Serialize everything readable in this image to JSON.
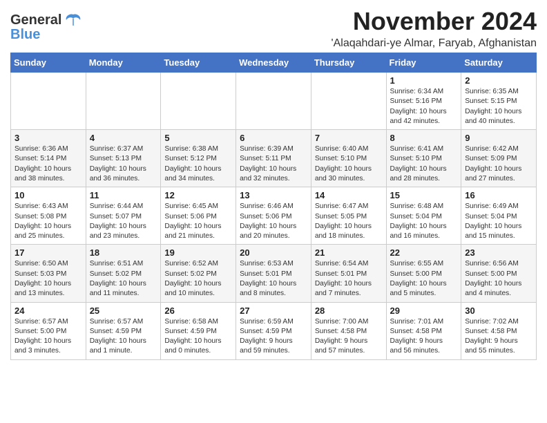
{
  "header": {
    "logo_line1": "General",
    "logo_line2": "Blue",
    "month": "November 2024",
    "location": "'Alaqahdari-ye Almar, Faryab, Afghanistan"
  },
  "weekdays": [
    "Sunday",
    "Monday",
    "Tuesday",
    "Wednesday",
    "Thursday",
    "Friday",
    "Saturday"
  ],
  "weeks": [
    [
      {
        "day": "",
        "info": ""
      },
      {
        "day": "",
        "info": ""
      },
      {
        "day": "",
        "info": ""
      },
      {
        "day": "",
        "info": ""
      },
      {
        "day": "",
        "info": ""
      },
      {
        "day": "1",
        "info": "Sunrise: 6:34 AM\nSunset: 5:16 PM\nDaylight: 10 hours\nand 42 minutes."
      },
      {
        "day": "2",
        "info": "Sunrise: 6:35 AM\nSunset: 5:15 PM\nDaylight: 10 hours\nand 40 minutes."
      }
    ],
    [
      {
        "day": "3",
        "info": "Sunrise: 6:36 AM\nSunset: 5:14 PM\nDaylight: 10 hours\nand 38 minutes."
      },
      {
        "day": "4",
        "info": "Sunrise: 6:37 AM\nSunset: 5:13 PM\nDaylight: 10 hours\nand 36 minutes."
      },
      {
        "day": "5",
        "info": "Sunrise: 6:38 AM\nSunset: 5:12 PM\nDaylight: 10 hours\nand 34 minutes."
      },
      {
        "day": "6",
        "info": "Sunrise: 6:39 AM\nSunset: 5:11 PM\nDaylight: 10 hours\nand 32 minutes."
      },
      {
        "day": "7",
        "info": "Sunrise: 6:40 AM\nSunset: 5:10 PM\nDaylight: 10 hours\nand 30 minutes."
      },
      {
        "day": "8",
        "info": "Sunrise: 6:41 AM\nSunset: 5:10 PM\nDaylight: 10 hours\nand 28 minutes."
      },
      {
        "day": "9",
        "info": "Sunrise: 6:42 AM\nSunset: 5:09 PM\nDaylight: 10 hours\nand 27 minutes."
      }
    ],
    [
      {
        "day": "10",
        "info": "Sunrise: 6:43 AM\nSunset: 5:08 PM\nDaylight: 10 hours\nand 25 minutes."
      },
      {
        "day": "11",
        "info": "Sunrise: 6:44 AM\nSunset: 5:07 PM\nDaylight: 10 hours\nand 23 minutes."
      },
      {
        "day": "12",
        "info": "Sunrise: 6:45 AM\nSunset: 5:06 PM\nDaylight: 10 hours\nand 21 minutes."
      },
      {
        "day": "13",
        "info": "Sunrise: 6:46 AM\nSunset: 5:06 PM\nDaylight: 10 hours\nand 20 minutes."
      },
      {
        "day": "14",
        "info": "Sunrise: 6:47 AM\nSunset: 5:05 PM\nDaylight: 10 hours\nand 18 minutes."
      },
      {
        "day": "15",
        "info": "Sunrise: 6:48 AM\nSunset: 5:04 PM\nDaylight: 10 hours\nand 16 minutes."
      },
      {
        "day": "16",
        "info": "Sunrise: 6:49 AM\nSunset: 5:04 PM\nDaylight: 10 hours\nand 15 minutes."
      }
    ],
    [
      {
        "day": "17",
        "info": "Sunrise: 6:50 AM\nSunset: 5:03 PM\nDaylight: 10 hours\nand 13 minutes."
      },
      {
        "day": "18",
        "info": "Sunrise: 6:51 AM\nSunset: 5:02 PM\nDaylight: 10 hours\nand 11 minutes."
      },
      {
        "day": "19",
        "info": "Sunrise: 6:52 AM\nSunset: 5:02 PM\nDaylight: 10 hours\nand 10 minutes."
      },
      {
        "day": "20",
        "info": "Sunrise: 6:53 AM\nSunset: 5:01 PM\nDaylight: 10 hours\nand 8 minutes."
      },
      {
        "day": "21",
        "info": "Sunrise: 6:54 AM\nSunset: 5:01 PM\nDaylight: 10 hours\nand 7 minutes."
      },
      {
        "day": "22",
        "info": "Sunrise: 6:55 AM\nSunset: 5:00 PM\nDaylight: 10 hours\nand 5 minutes."
      },
      {
        "day": "23",
        "info": "Sunrise: 6:56 AM\nSunset: 5:00 PM\nDaylight: 10 hours\nand 4 minutes."
      }
    ],
    [
      {
        "day": "24",
        "info": "Sunrise: 6:57 AM\nSunset: 5:00 PM\nDaylight: 10 hours\nand 3 minutes."
      },
      {
        "day": "25",
        "info": "Sunrise: 6:57 AM\nSunset: 4:59 PM\nDaylight: 10 hours\nand 1 minute."
      },
      {
        "day": "26",
        "info": "Sunrise: 6:58 AM\nSunset: 4:59 PM\nDaylight: 10 hours\nand 0 minutes."
      },
      {
        "day": "27",
        "info": "Sunrise: 6:59 AM\nSunset: 4:59 PM\nDaylight: 9 hours\nand 59 minutes."
      },
      {
        "day": "28",
        "info": "Sunrise: 7:00 AM\nSunset: 4:58 PM\nDaylight: 9 hours\nand 57 minutes."
      },
      {
        "day": "29",
        "info": "Sunrise: 7:01 AM\nSunset: 4:58 PM\nDaylight: 9 hours\nand 56 minutes."
      },
      {
        "day": "30",
        "info": "Sunrise: 7:02 AM\nSunset: 4:58 PM\nDaylight: 9 hours\nand 55 minutes."
      }
    ]
  ]
}
